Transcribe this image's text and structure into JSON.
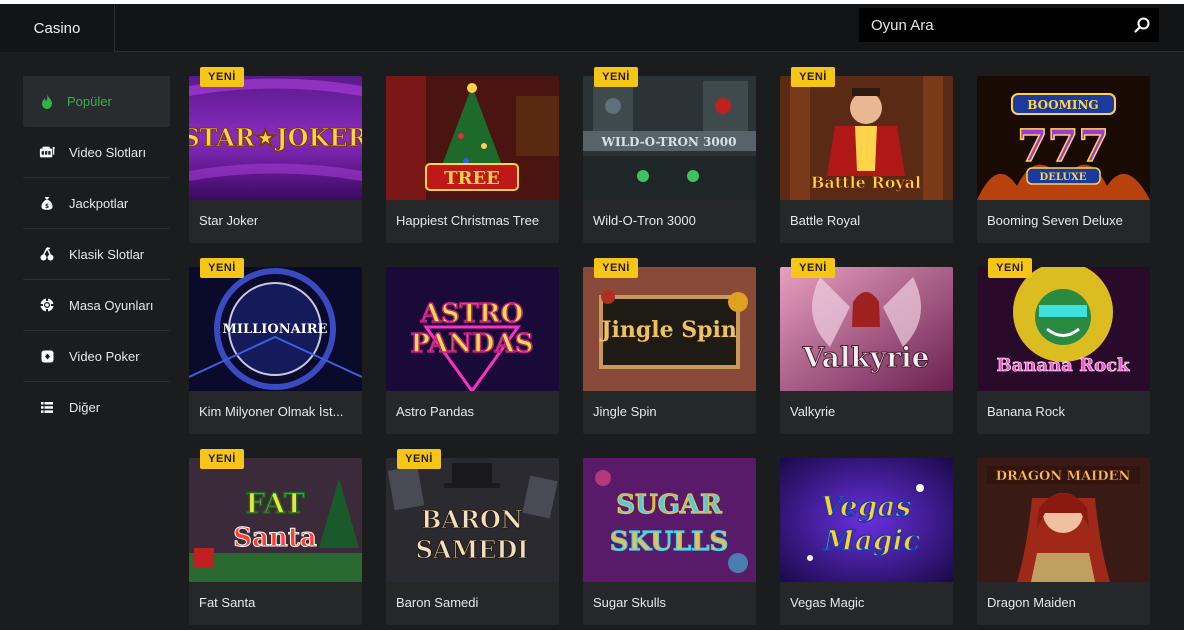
{
  "header": {
    "tab_label": "Casino",
    "search_placeholder": "Oyun Ara"
  },
  "sidebar": {
    "items": [
      {
        "label": "Popüler",
        "icon": "flame-icon",
        "active": true
      },
      {
        "label": "Video Slotları",
        "icon": "slot-machine-icon",
        "active": false
      },
      {
        "label": "Jackpotlar",
        "icon": "money-bag-icon",
        "active": false
      },
      {
        "label": "Klasik Slotlar",
        "icon": "cherries-icon",
        "active": false
      },
      {
        "label": "Masa Oyunları",
        "icon": "chip-icon",
        "active": false
      },
      {
        "label": "Video Poker",
        "icon": "card-icon",
        "active": false
      },
      {
        "label": "Diğer",
        "icon": "list-icon",
        "active": false
      }
    ]
  },
  "badge_label": "YENİ",
  "games": [
    {
      "title": "Star Joker",
      "logo": "STAR★JOKER",
      "new": true
    },
    {
      "title": "Happiest Christmas Tree",
      "logo": "TREE",
      "new": false
    },
    {
      "title": "Wild-O-Tron 3000",
      "logo": "WILD-O-TRON 3000",
      "new": true
    },
    {
      "title": "Battle Royal",
      "logo": "Battle Royal",
      "new": true
    },
    {
      "title": "Booming Seven Deluxe",
      "logo": "777",
      "new": false
    },
    {
      "title": "Kim Milyoner Olmak İst...",
      "logo": "MILLIONAIRE",
      "new": true
    },
    {
      "title": "Astro Pandas",
      "logo": "ASTRO PANDAS",
      "new": false
    },
    {
      "title": "Jingle Spin",
      "logo": "Jingle Spin",
      "new": true
    },
    {
      "title": "Valkyrie",
      "logo": "Valkyrie",
      "new": true
    },
    {
      "title": "Banana Rock",
      "logo": "Banana Rock",
      "new": true
    },
    {
      "title": "Fat Santa",
      "logo": "FAT Santa",
      "new": true
    },
    {
      "title": "Baron Samedi",
      "logo": "BARON SAMEDI",
      "new": true
    },
    {
      "title": "Sugar Skulls",
      "logo": "SUGAR SKULLS",
      "new": false
    },
    {
      "title": "Vegas Magic",
      "logo": "Vegas Magic",
      "new": false
    },
    {
      "title": "Dragon Maiden",
      "logo": "DRAGON MAIDEN",
      "new": false
    }
  ],
  "colors": {
    "accent_green": "#2fb44a",
    "badge_yellow": "#f5c518",
    "background": "#1b1c1e",
    "card": "#262729"
  }
}
